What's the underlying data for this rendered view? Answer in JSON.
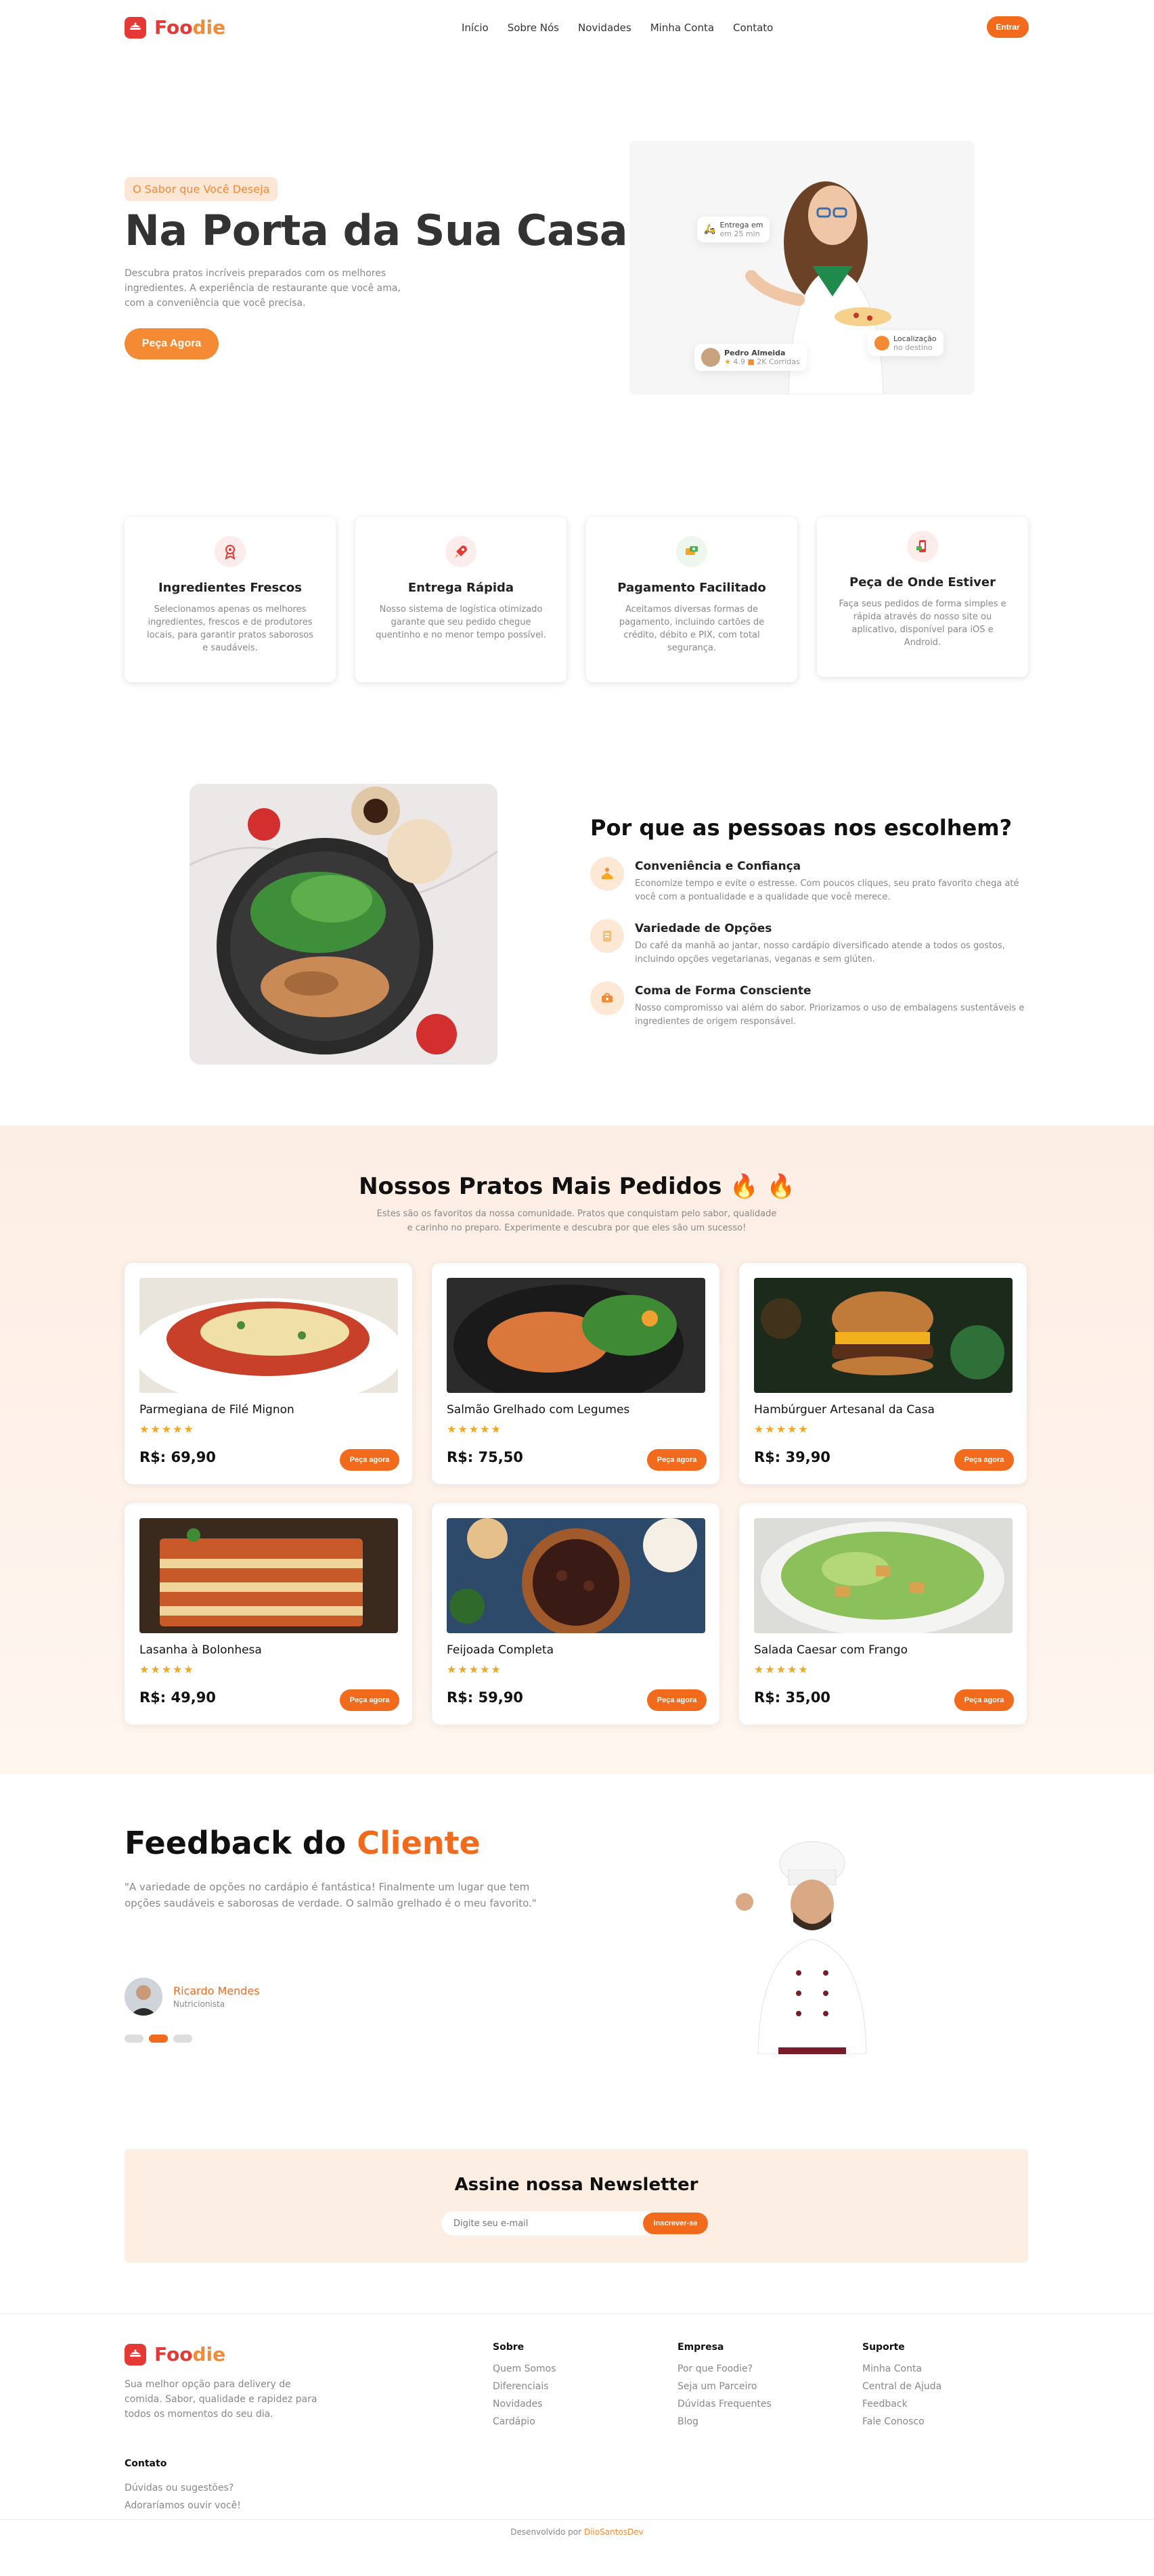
{
  "brand": {
    "name_a": "Foo",
    "name_b": "die",
    "color": "#e53935",
    "accent": "#f26b1d"
  },
  "nav": {
    "links": [
      "Início",
      "Sobre Nós",
      "Novidades",
      "Minha Conta",
      "Contato"
    ],
    "login": "Entrar"
  },
  "hero": {
    "badge": "O Sabor que Você Deseja",
    "title": "Na Porta da Sua Casa",
    "desc": "Descubra pratos incríveis preparados com os melhores ingredientes. A experiência de restaurante que você ama, com a conveniência que você precisa.",
    "cta": "Peça Agora",
    "card_delivery_title": "Entrega em",
    "card_delivery_time": "em 25 min",
    "card_courier_name": "Pedro Almeida",
    "card_courier_rating": "4.9",
    "card_courier_orders": "2K Corridas",
    "card_location_title": "Localização",
    "card_location_sub": "no destino"
  },
  "features": [
    {
      "icon": "award-icon",
      "title": "Ingredientes Frescos",
      "desc": "Selecionamos apenas os melhores ingredientes, frescos e de produtores locais, para garantir pratos saborosos e saudáveis."
    },
    {
      "icon": "rocket-icon",
      "title": "Entrega Rápida",
      "desc": "Nosso sistema de logística otimizado garante que seu pedido chegue quentinho e no menor tempo possível."
    },
    {
      "icon": "payment-icon",
      "title": "Pagamento Facilitado",
      "desc": "Aceitamos diversas formas de pagamento, incluindo cartões de crédito, débito e PIX, com total segurança."
    },
    {
      "icon": "mobile-order-icon",
      "title": "Peça de Onde Estiver",
      "desc": "Faça seus pedidos de forma simples e rápida através do nosso site ou aplicativo, disponível para iOS e Android."
    }
  ],
  "why": {
    "title": "Por que as pessoas nos escolhem?",
    "items": [
      {
        "icon": "convenience-icon",
        "title": "Conveniência e Confiança",
        "desc": "Economize tempo e evite o estresse. Com poucos cliques, seu prato favorito chega até você com a pontualidade e a qualidade que você merece."
      },
      {
        "icon": "menu-icon",
        "title": "Variedade de Opções",
        "desc": "Do café da manhã ao jantar, nosso cardápio diversificado atende a todos os gostos, incluindo opções vegetarianas, veganas e sem glúten."
      },
      {
        "icon": "eco-icon",
        "title": "Coma de Forma Consciente",
        "desc": "Nosso compromisso vai além do sabor. Priorizamos o uso de embalagens sustentáveis e ingredientes de origem responsável."
      }
    ]
  },
  "dishes": {
    "title": "Nossos Pratos Mais Pedidos",
    "fire": "🔥 🔥",
    "desc": "Estes são os favoritos da nossa comunidade. Pratos que conquistam pelo sabor, qualidade e carinho no preparo. Experimente e descubra por que eles são um sucesso!",
    "order_label": "Peça agora",
    "items": [
      {
        "name": "Parmegiana de Filé Mignon",
        "price": "R$: 69,90",
        "rating": 5
      },
      {
        "name": "Salmão Grelhado com Legumes",
        "price": "R$: 75,50",
        "rating": 5
      },
      {
        "name": "Hambúrguer Artesanal da Casa",
        "price": "R$: 39,90",
        "rating": 5
      },
      {
        "name": "Lasanha à Bolonhesa",
        "price": "R$: 49,90",
        "rating": 5
      },
      {
        "name": "Feijoada Completa",
        "price": "R$: 59,90",
        "rating": 5
      },
      {
        "name": "Salada Caesar com Frango",
        "price": "R$: 35,00",
        "rating": 5
      }
    ]
  },
  "feedback": {
    "title_a": "Feedback do",
    "title_b": "Cliente",
    "quote": "\"A variedade de opções no cardápio é fantástica! Finalmente um lugar que tem opções saudáveis e saborosas de verdade. O salmão grelhado é o meu favorito.\"",
    "name": "Ricardo Mendes",
    "role": "Nutricionista",
    "active_slide": 2,
    "slides": 3
  },
  "newsletter": {
    "title": "Assine nossa Newsletter",
    "placeholder": "Digite seu e-mail",
    "button": "Inscrever-se"
  },
  "footer": {
    "desc": "Sua melhor opção para delivery de comida. Sabor, qualidade e rapidez para todos os momentos do seu dia.",
    "cols": [
      {
        "title": "Sobre",
        "links": [
          "Quem Somos",
          "Diferenciais",
          "Novidades",
          "Cardápio"
        ]
      },
      {
        "title": "Empresa",
        "links": [
          "Por que Foodie?",
          "Seja um Parceiro",
          "Dúvidas Frequentes",
          "Blog"
        ]
      },
      {
        "title": "Suporte",
        "links": [
          "Minha Conta",
          "Central de Ajuda",
          "Feedback",
          "Fale Conosco"
        ]
      }
    ],
    "contact_title": "Contato",
    "contact_lines": [
      "Dúvidas ou sugestões?",
      "Adoraríamos ouvir você!"
    ],
    "credit_a": "Desenvolvido por",
    "credit_b": "DiioSantosDev"
  }
}
